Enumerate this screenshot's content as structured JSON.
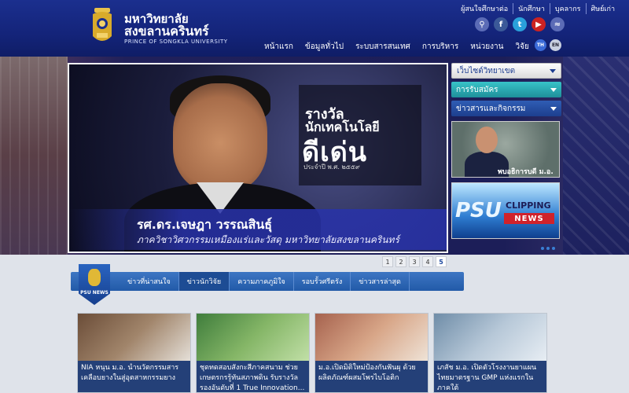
{
  "header": {
    "logo_th_line1": "มหาวิทยาลัย",
    "logo_th_line2": "สงขลานครินทร์",
    "logo_en": "PRINCE OF SONGKLA UNIVERSITY",
    "top_links": [
      "ผู้สนใจศึกษาต่อ",
      "นักศึกษา",
      "บุคลากร",
      "ศิษย์เก่า"
    ],
    "social_icons": [
      "search-icon",
      "facebook-icon",
      "twitter-icon",
      "youtube-icon",
      "rss-icon"
    ],
    "nav": [
      "หน้าแรก",
      "ข้อมูลทั่วไป",
      "ระบบสารสนเทศ",
      "การบริหาร",
      "หน่วยงาน",
      "วิจัย"
    ],
    "lang": {
      "th": "TH",
      "en": "EN"
    }
  },
  "slider": {
    "award_line1": "รางวัล",
    "award_line2": "นักเทคโนโลยี",
    "award_line3": "ดีเด่น",
    "award_line4": "ประจำปี พ.ศ. ๒๕๕๙",
    "caption_name": "รศ.ดร.เจษฎา วรรณสินธุ์",
    "caption_sub": "ภาควิชาวิศวกรรมเหมืองแร่และวัสดุ มหาวิทยาลัยสงขลานครินทร์",
    "pages": [
      "1",
      "2",
      "3",
      "4",
      "5"
    ],
    "active_page": "5"
  },
  "sidebar": {
    "buttons": [
      "เว็บไซต์วิทยาเขต",
      "การรับสมัคร",
      "ข่าวสารและกิจกรรม"
    ],
    "card1_label": "พบอธิการบดี ม.อ.",
    "card2": {
      "psu": "PSU",
      "clipping": "CLIPPING",
      "news": "NEWS"
    }
  },
  "news": {
    "badge": "PSU NEWS",
    "tabs": [
      "ข่าวที่น่าสนใจ",
      "ข่าวนักวิจัย",
      "ความภาคภูมิใจ",
      "รอบรั้วศรีตรัง",
      "ข่าวสารล่าสุด"
    ],
    "active_tab": 1,
    "items": [
      "NIA หนุน ม.อ. นำนวัตกรรมสาร เคลือบยางในสู่อุตสาหกรรมยาง",
      "ชุดทดสอบสังกะสีภาคสนาม ช่วย เกษตรกรรู้ทันสภาพดิน รับรางวัล รองอันดับที่ 1 True Innovation...",
      "ม.อ.เปิดมิติใหม่ป้องกันฟันผุ ด้วย ผลิตภัณฑ์ผสมโพรไบโอติก",
      "เภสัช ม.อ. เปิดตัวโรงงานยาแผน ไทยมาตรฐาน GMP แห่งแรกใน ภาคใต้"
    ]
  },
  "colors": {
    "header_blue": "#14247a",
    "accent_teal": "#1e8f9a",
    "news_blue": "#225aa8",
    "clip_red": "#d0222b"
  }
}
